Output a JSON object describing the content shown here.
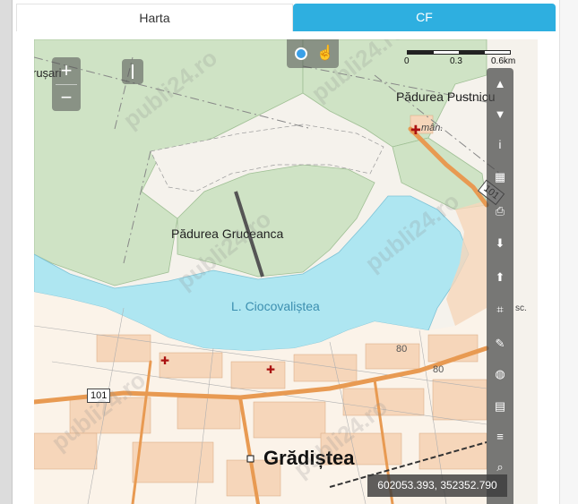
{
  "tabs": [
    {
      "label": "Harta",
      "active": false
    },
    {
      "label": "CF",
      "active": true
    }
  ],
  "colors": {
    "tab_active": "#2eafe0",
    "forest": "#cfe3c5",
    "lake": "#aee6f1",
    "road": "#e89a52",
    "urban": "#f6d6ba"
  },
  "map": {
    "zoom_in_label": "+",
    "zoom_out_label": "−",
    "scale": {
      "ticks": [
        "0",
        "0.3",
        "0.6km"
      ]
    },
    "labels": {
      "pustnicu": "Pădurea Pustnicu",
      "gruceanca": "Pădurea Gruceanca",
      "lake": "L. Ciocovaliștea",
      "town": "Grădiștea",
      "rusari": "rușari",
      "man": "mân.",
      "sc": "sc.",
      "road_80_a": "80",
      "road_80_b": "80",
      "road_101_a": "101",
      "road_101_b": "101"
    },
    "coordinates": "602053.393, 352352.790",
    "watermark": "publi24.ro"
  },
  "toolbar": {
    "tools": [
      {
        "name": "elevation-profile-icon",
        "glyph": "▲"
      },
      {
        "name": "filter-icon",
        "glyph": "▼"
      },
      {
        "name": "info-icon",
        "glyph": "i"
      },
      {
        "name": "table-icon",
        "glyph": "▦"
      },
      {
        "name": "print-icon",
        "glyph": "⎙"
      },
      {
        "name": "download-icon",
        "glyph": "⬇"
      },
      {
        "name": "upload-icon",
        "glyph": "⬆"
      },
      {
        "name": "crop-icon",
        "glyph": "⌗"
      },
      {
        "name": "measure-icon",
        "glyph": "✎"
      },
      {
        "name": "globe-icon",
        "glyph": "◍"
      },
      {
        "name": "map-icon",
        "glyph": "▤"
      },
      {
        "name": "menu-icon",
        "glyph": "≡"
      },
      {
        "name": "search-icon",
        "glyph": "⌕"
      }
    ]
  }
}
